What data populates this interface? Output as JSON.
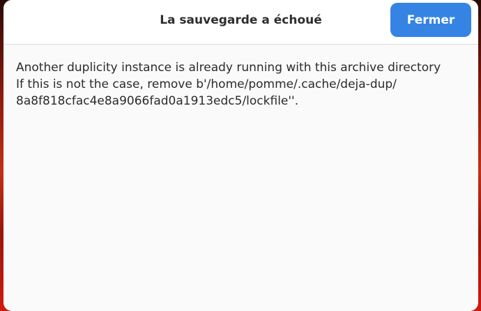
{
  "dialog": {
    "title": "La sauvegarde a échoué",
    "close_label": "Fermer",
    "message_lines": [
      "Another duplicity instance is already running with this archive directory",
      "If this is not the case, remove b'/home/pomme/.cache/deja-dup/",
      "8a8f818cfac4e8a9066fad0a1913edc5/lockfile''."
    ]
  },
  "colors": {
    "accent": "#3584e4",
    "dialog_background": "#fafafa",
    "header_background": "#ffffff",
    "desktop_background": "#7a0f06"
  }
}
